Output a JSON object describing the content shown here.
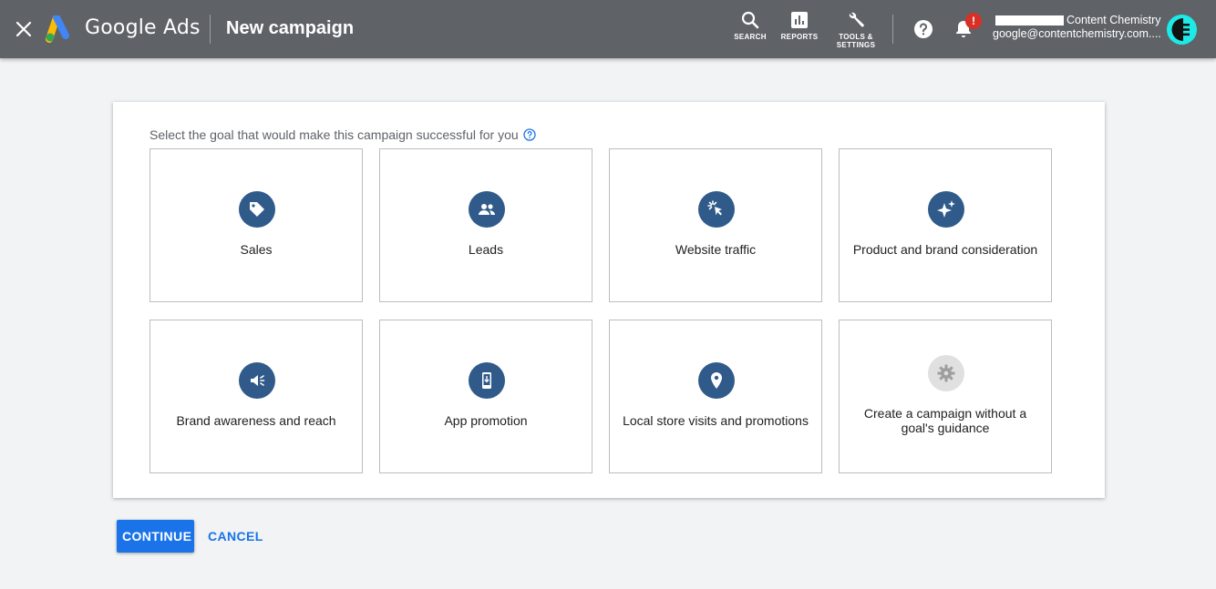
{
  "header": {
    "brand": "Google Ads",
    "title": "New campaign",
    "tools": {
      "search": "SEARCH",
      "reports": "REPORTS",
      "settings_line1": "TOOLS &",
      "settings_line2": "SETTINGS"
    },
    "notification_badge": "!",
    "account_name": "Content Chemistry",
    "account_email": "google@contentchemistry.com...."
  },
  "main": {
    "prompt": "Select the goal that would make this campaign successful for you",
    "goals": [
      {
        "label": "Sales",
        "icon": "tag-icon"
      },
      {
        "label": "Leads",
        "icon": "people-icon"
      },
      {
        "label": "Website traffic",
        "icon": "cursor-click-icon"
      },
      {
        "label": "Product and brand consideration",
        "icon": "sparkle-icon"
      },
      {
        "label": "Brand awareness and reach",
        "icon": "megaphone-icon"
      },
      {
        "label": "App promotion",
        "icon": "phone-download-icon"
      },
      {
        "label": "Local store visits and promotions",
        "icon": "location-pin-icon"
      },
      {
        "label": "Create a campaign without a goal's guidance",
        "icon": "gear-icon"
      }
    ]
  },
  "actions": {
    "continue": "CONTINUE",
    "cancel": "CANCEL"
  },
  "colors": {
    "header_bg": "#5f6368",
    "icon_circle": "#2f5a8a",
    "primary": "#1a73e8",
    "badge": "#d93025",
    "avatar": "#1de9e6"
  }
}
